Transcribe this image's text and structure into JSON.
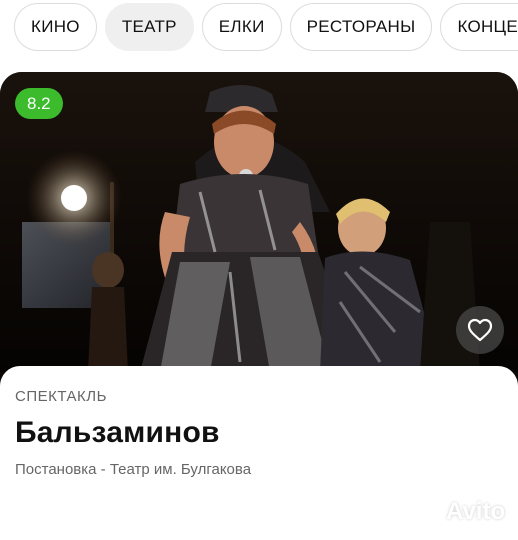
{
  "categories": [
    {
      "label": "КИНО",
      "active": false
    },
    {
      "label": "ТЕАТР",
      "active": true
    },
    {
      "label": "ЕЛКИ",
      "active": false
    },
    {
      "label": "РЕСТОРАНЫ",
      "active": false
    },
    {
      "label": "КОНЦЕРТЫ",
      "active": false
    }
  ],
  "card": {
    "rating": "8.2",
    "rating_color": "#3cbc2c",
    "type": "СПЕКТАКЛЬ",
    "title": "Бальзаминов",
    "subtitle": "Постановка - Театр им. Булгакова",
    "favorite_icon": "heart-icon"
  },
  "watermark": {
    "text": "Avito"
  }
}
